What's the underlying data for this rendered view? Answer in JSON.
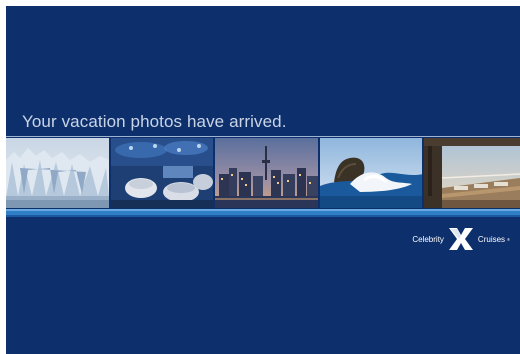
{
  "headline": "Your vacation photos have arrived.",
  "photos": [
    {
      "subject": "glacier"
    },
    {
      "subject": "ship-lounge-interior"
    },
    {
      "subject": "city-skyline-dusk"
    },
    {
      "subject": "ocean-wave-rock"
    },
    {
      "subject": "ship-deck"
    }
  ],
  "logo": {
    "word_left": "Celebrity",
    "word_right": "Cruises",
    "reg_mark": "®"
  },
  "colors": {
    "background": "#0d2f6b",
    "headline": "#c9d4e6",
    "band_light": "#6aa8df",
    "band_mid": "#2f7fc6"
  }
}
